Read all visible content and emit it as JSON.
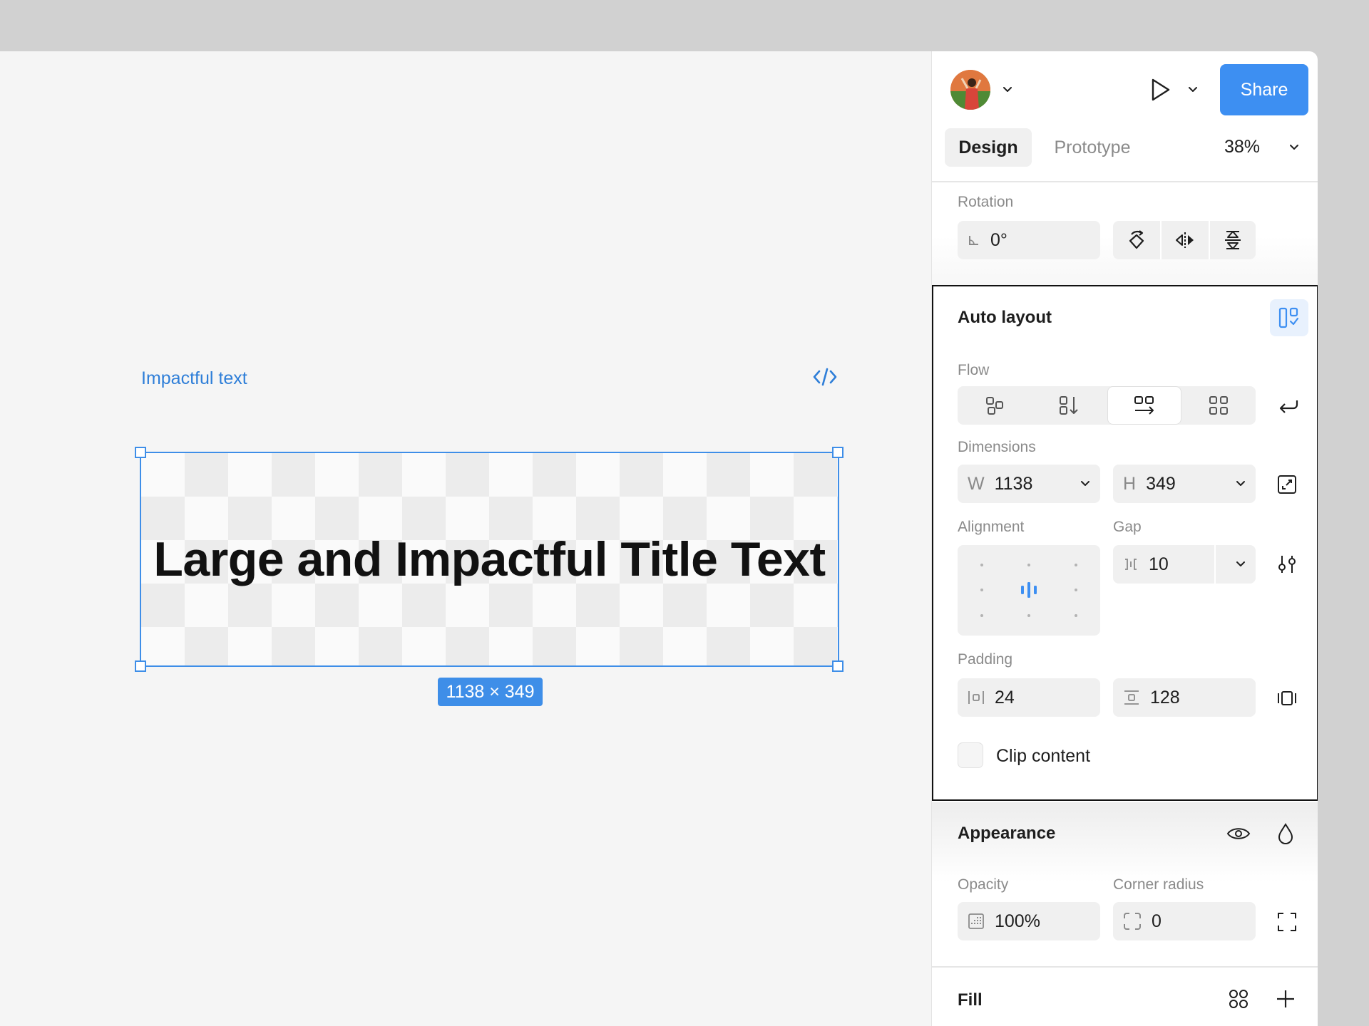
{
  "canvas": {
    "frame_label": "Impactful text",
    "title_text": "Large and Impactful Title Text",
    "dimension_badge": "1138 × 349"
  },
  "header": {
    "share_label": "Share",
    "tabs": {
      "design": "Design",
      "prototype": "Prototype"
    },
    "zoom": "38%"
  },
  "rotation": {
    "label": "Rotation",
    "value": "0°"
  },
  "auto_layout": {
    "title": "Auto layout",
    "flow_label": "Flow",
    "flow_selected": "wrap",
    "dimensions_label": "Dimensions",
    "width_prefix": "W",
    "width": "1138",
    "height_prefix": "H",
    "height": "349",
    "alignment_label": "Alignment",
    "gap_label": "Gap",
    "gap": "10",
    "padding_label": "Padding",
    "padding_horizontal": "24",
    "padding_vertical": "128",
    "clip_content_label": "Clip content",
    "clip_content": false
  },
  "appearance": {
    "title": "Appearance",
    "opacity_label": "Opacity",
    "opacity": "100%",
    "corner_radius_label": "Corner radius",
    "corner_radius": "0"
  },
  "fill": {
    "title": "Fill"
  },
  "colors": {
    "accent": "#3d8ff2",
    "selection": "#3e8ee8"
  }
}
